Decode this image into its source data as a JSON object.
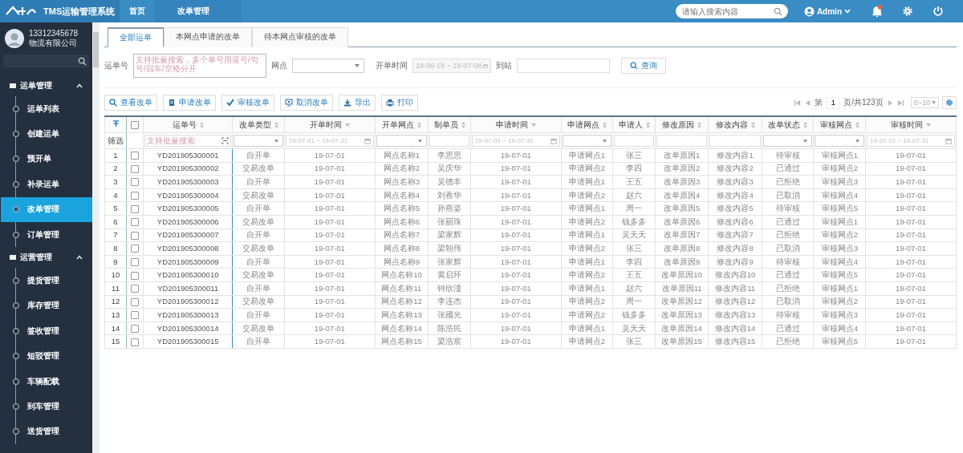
{
  "header": {
    "title": "TMS运输管理系统",
    "nav": [
      {
        "label": "首页",
        "selected": false
      },
      {
        "label": "改单管理",
        "selected": true
      }
    ],
    "search": {
      "placeholder": "请输入搜索内容"
    },
    "user": "Admin"
  },
  "sidebar": {
    "phone": "13312345678",
    "company": "物流有限公司",
    "groups": [
      {
        "label": "运单管理",
        "expanded": true,
        "children": [
          {
            "label": "运单列表",
            "selected": false
          },
          {
            "label": "创建运单",
            "selected": false
          },
          {
            "label": "预开单",
            "selected": false
          },
          {
            "label": "补录运单",
            "selected": false
          },
          {
            "label": "改单管理",
            "selected": true
          },
          {
            "label": "订单管理",
            "selected": false
          }
        ]
      },
      {
        "label": "运营管理",
        "expanded": true,
        "children": [
          {
            "label": "提货管理",
            "selected": false
          },
          {
            "label": "库存管理",
            "selected": false
          },
          {
            "label": "签收管理",
            "selected": false
          },
          {
            "label": "短驳管理",
            "selected": false
          },
          {
            "label": "车辆配载",
            "selected": false
          },
          {
            "label": "到车管理",
            "selected": false
          },
          {
            "label": "送货管理",
            "selected": false
          }
        ]
      }
    ]
  },
  "tabs": [
    {
      "label": "全部运单",
      "selected": true
    },
    {
      "label": "本网点申请的改单",
      "selected": false
    },
    {
      "label": "待本网点审核的改单",
      "selected": false
    }
  ],
  "search_form": {
    "waybill_label": "运单号",
    "waybill_placeholder": "支持批量搜索，多个单号用逗号/句号/回车/空格分开",
    "site_label": "网点",
    "time_label": "开单时间",
    "time_value": "18-06-19 ~ 18-07-08",
    "station_label": "到站",
    "query_button": "查询"
  },
  "toolbar": [
    "查看改单",
    "申请改单",
    "审核改单",
    "取消改单",
    "导出",
    "打印"
  ],
  "pagination": {
    "prefix": "第",
    "page": "1",
    "suffix": "页/共123页",
    "page_size": "0~10"
  },
  "table": {
    "filter_label": "筛选",
    "header_checked": false,
    "columns": [
      {
        "label": "运单号",
        "kind": "text",
        "filter": {
          "kind": "text",
          "placeholder": "支持批量搜索"
        }
      },
      {
        "label": "改单类型",
        "kind": "text",
        "filter": {
          "kind": "select"
        }
      },
      {
        "label": "开单时间",
        "kind": "date",
        "filter": {
          "kind": "date",
          "value": "19-07-01 ~ 19-07-31"
        }
      },
      {
        "label": "开单网点",
        "kind": "text",
        "filter": {
          "kind": "select"
        }
      },
      {
        "label": "制单员",
        "kind": "text",
        "filter": {
          "kind": "text"
        }
      },
      {
        "label": "申请时间",
        "kind": "date",
        "filter": {
          "kind": "date",
          "value": "19-07-01 ~ 19-07-31"
        }
      },
      {
        "label": "申请网点",
        "kind": "text",
        "filter": {
          "kind": "select"
        }
      },
      {
        "label": "申请人",
        "kind": "text",
        "filter": {
          "kind": "text"
        }
      },
      {
        "label": "修改原因",
        "kind": "text",
        "filter": {
          "kind": "text"
        }
      },
      {
        "label": "修改内容",
        "kind": "text",
        "filter": {
          "kind": "text"
        }
      },
      {
        "label": "改单状态",
        "kind": "text",
        "filter": {
          "kind": "select"
        }
      },
      {
        "label": "审核网点",
        "kind": "text",
        "filter": {
          "kind": "select"
        }
      },
      {
        "label": "审核时间",
        "kind": "date",
        "filter": {
          "kind": "date",
          "value": "19-07-01 ~ 19-07-31"
        }
      }
    ],
    "rows": [
      {
        "index": "1",
        "checked": false,
        "cells": [
          "YD201905300001",
          "自开单",
          "19-07-01",
          "网点名称1",
          "李思思",
          "19-07-01",
          "申请网点1",
          "张三",
          "改单原因1",
          "修改内容1",
          "待审核",
          "审核网点1",
          "19-07-01"
        ]
      },
      {
        "index": "2",
        "checked": false,
        "cells": [
          "YD201905300002",
          "交易改单",
          "19-07-01",
          "网点名称2",
          "吴庆华",
          "19-07-01",
          "申请网点2",
          "李四",
          "改单原因2",
          "修改内容2",
          "已通过",
          "审核网点2",
          "19-07-01"
        ]
      },
      {
        "index": "3",
        "checked": false,
        "cells": [
          "YD201905300003",
          "自开单",
          "19-07-01",
          "网点名称3",
          "吴德丰",
          "19-07-01",
          "申请网点1",
          "王五",
          "改单原因3",
          "修改内容3",
          "已拒绝",
          "审核网点3",
          "19-07-01"
        ]
      },
      {
        "index": "4",
        "checked": false,
        "cells": [
          "YD201905300004",
          "交易改单",
          "19-07-01",
          "网点名称4",
          "刘香华",
          "19-07-01",
          "申请网点2",
          "赵六",
          "改单原因4",
          "修改内容4",
          "已取消",
          "审核网点4",
          "19-07-01"
        ]
      },
      {
        "index": "5",
        "checked": false,
        "cells": [
          "YD201905300005",
          "自开单",
          "19-07-01",
          "网点名称5",
          "孙燕姿",
          "19-07-01",
          "申请网点1",
          "周一",
          "改单原因5",
          "修改内容5",
          "待审核",
          "审核网点5",
          "19-07-01"
        ]
      },
      {
        "index": "6",
        "checked": false,
        "cells": [
          "YD201905300006",
          "交易改单",
          "19-07-01",
          "网点名称6",
          "张丽珠",
          "19-07-01",
          "申请网点2",
          "钱多多",
          "改单原因6",
          "修改内容6",
          "已通过",
          "审核网点1",
          "19-07-01"
        ]
      },
      {
        "index": "7",
        "checked": false,
        "cells": [
          "YD201905300007",
          "自开单",
          "19-07-01",
          "网点名称7",
          "梁家辉",
          "19-07-01",
          "申请网点1",
          "吴天天",
          "改单原因7",
          "修改内容7",
          "已拒绝",
          "审核网点2",
          "19-07-01"
        ]
      },
      {
        "index": "8",
        "checked": false,
        "cells": [
          "YD201905300008",
          "交易改单",
          "19-07-01",
          "网点名称8",
          "梁朝伟",
          "19-07-01",
          "申请网点2",
          "张三",
          "改单原因8",
          "修改内容8",
          "已取消",
          "审核网点3",
          "19-07-01"
        ]
      },
      {
        "index": "9",
        "checked": false,
        "cells": [
          "YD201905300009",
          "自开单",
          "19-07-01",
          "网点名称9",
          "张家辉",
          "19-07-01",
          "申请网点1",
          "李四",
          "改单原因9",
          "修改内容9",
          "待审核",
          "审核网点4",
          "19-07-01"
        ]
      },
      {
        "index": "10",
        "checked": false,
        "cells": [
          "YD201905300010",
          "交易改单",
          "19-07-01",
          "网点名称10",
          "黄启环",
          "19-07-01",
          "申请网点2",
          "王五",
          "改单原因10",
          "修改内容10",
          "已通过",
          "审核网点5",
          "19-07-01"
        ]
      },
      {
        "index": "11",
        "checked": false,
        "cells": [
          "YD201905300011",
          "自开单",
          "19-07-01",
          "网点名称11",
          "钟欣潼",
          "19-07-01",
          "申请网点1",
          "赵六",
          "改单原因11",
          "修改内容11",
          "已拒绝",
          "审核网点1",
          "19-07-01"
        ]
      },
      {
        "index": "12",
        "checked": false,
        "cells": [
          "YD201905300012",
          "交易改单",
          "19-07-01",
          "网点名称12",
          "李连杰",
          "19-07-01",
          "申请网点2",
          "周一",
          "改单原因12",
          "修改内容12",
          "已取消",
          "审核网点2",
          "19-07-01"
        ]
      },
      {
        "index": "13",
        "checked": false,
        "cells": [
          "YD201905300013",
          "自开单",
          "19-07-01",
          "网点名称13",
          "张國光",
          "19-07-01",
          "申请网点2",
          "钱多多",
          "改单原因13",
          "修改内容13",
          "待审核",
          "审核网点3",
          "19-07-01"
        ]
      },
      {
        "index": "14",
        "checked": false,
        "cells": [
          "YD201905300014",
          "交易改单",
          "19-07-01",
          "网点名称14",
          "陈浩民",
          "19-07-01",
          "申请网点1",
          "吴天天",
          "改单原因14",
          "修改内容14",
          "已通过",
          "审核网点4",
          "19-07-01"
        ]
      },
      {
        "index": "15",
        "checked": false,
        "cells": [
          "YD201905300015",
          "自开单",
          "19-07-01",
          "网点名称15",
          "梁浩宸",
          "19-07-01",
          "申请网点2",
          "张三",
          "改单原因15",
          "修改内容15",
          "已拒绝",
          "审核网点5",
          "19-07-01"
        ]
      }
    ]
  }
}
